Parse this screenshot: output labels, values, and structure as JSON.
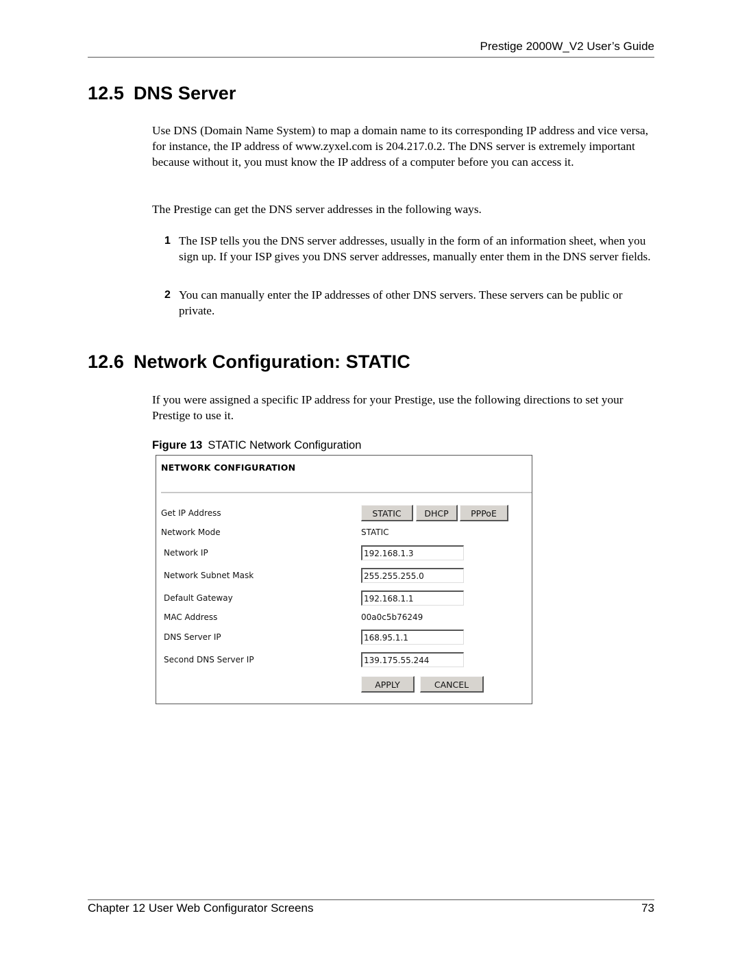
{
  "header": {
    "running_title": "Prestige 2000W_V2 User’s Guide"
  },
  "section_dns": {
    "number": "12.5",
    "title": "DNS Server",
    "paragraph1": "Use DNS (Domain Name System) to map a domain name to its corresponding IP address and vice versa, for instance, the IP address of www.zyxel.com is 204.217.0.2. The DNS server is extremely important because without it, you must know the IP address of a computer before you can access it.",
    "paragraph2": "The Prestige can get the DNS server addresses in the following ways.",
    "list": [
      {
        "num": "1",
        "text": "The ISP tells you the DNS server addresses, usually in the form of an information sheet, when you sign up. If your ISP gives you DNS server addresses, manually enter them in the DNS server fields."
      },
      {
        "num": "2",
        "text": "You can manually enter the IP addresses of other DNS servers. These servers can be public or private."
      }
    ]
  },
  "section_static": {
    "number": "12.6",
    "title": "Network Configuration: STATIC",
    "paragraph1": "If you were assigned a specific IP address for your Prestige, use the following directions to set your Prestige to use it.",
    "figure": {
      "label": "Figure 13",
      "caption": "STATIC Network Configuration"
    }
  },
  "panel": {
    "title": "NETWORK CONFIGURATION",
    "get_ip_label": "Get IP Address",
    "mode_buttons": [
      "STATIC",
      "DHCP",
      "PPPoE"
    ],
    "network_mode_label": "Network Mode",
    "network_mode_value": "STATIC",
    "network_ip_label": "Network IP",
    "network_ip_value": "192.168.1.3",
    "subnet_label": "Network Subnet Mask",
    "subnet_value": "255.255.255.0",
    "gateway_label": "Default Gateway",
    "gateway_value": "192.168.1.1",
    "mac_label": "MAC Address",
    "mac_value": "00a0c5b76249",
    "dns1_label": "DNS Server IP",
    "dns1_value": "168.95.1.1",
    "dns2_label": "Second DNS Server IP",
    "dns2_value": "139.175.55.244",
    "apply_label": "APPLY",
    "cancel_label": "CANCEL"
  },
  "footer": {
    "chapter": "Chapter 12 User Web Configurator Screens",
    "page_number": "73"
  }
}
